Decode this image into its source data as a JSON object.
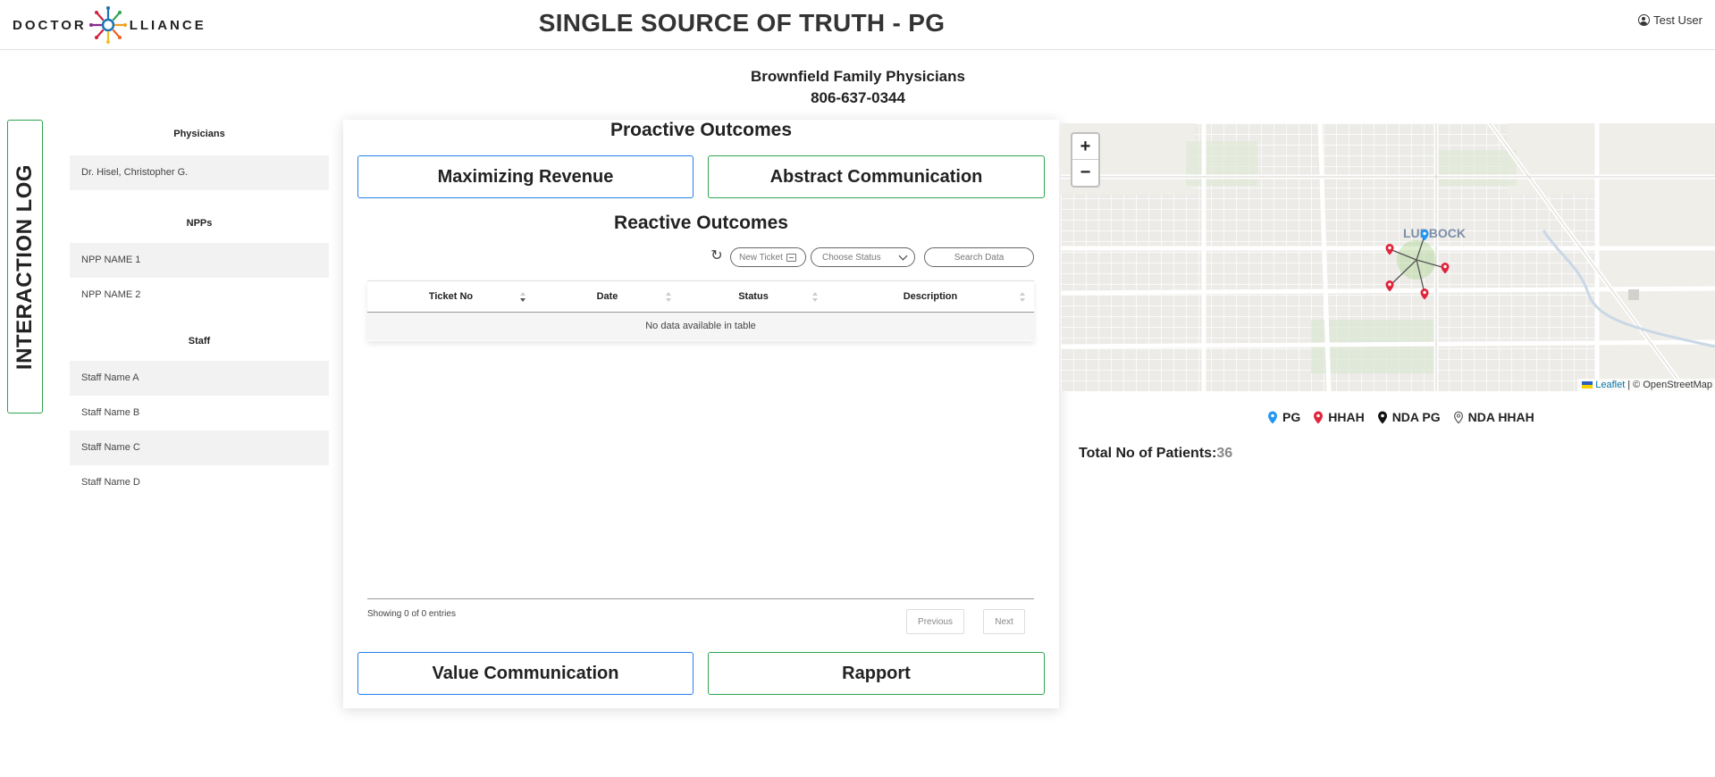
{
  "header": {
    "logo_left": "DOCTOR",
    "logo_right": "LLIANCE",
    "title": "SINGLE SOURCE OF TRUTH - PG",
    "user": "Test User"
  },
  "practice": {
    "name": "Brownfield Family Physicians",
    "phone": "806-637-0344"
  },
  "interaction_log": "INTERACTION LOG",
  "people": {
    "physicians_title": "Physicians",
    "physicians": [
      "Dr. Hisel, Christopher G."
    ],
    "npps_title": "NPPs",
    "npps": [
      "NPP NAME 1",
      "NPP NAME 2"
    ],
    "staff_title": "Staff",
    "staff": [
      "Staff Name A",
      "Staff Name B",
      "Staff Name C",
      "Staff Name D"
    ]
  },
  "center": {
    "proactive_title": "Proactive Outcomes",
    "maximizing_revenue": "Maximizing Revenue",
    "abstract_communication": "Abstract Communication",
    "reactive_title": "Reactive Outcomes",
    "new_ticket": "New Ticket",
    "choose_status": "Choose Status",
    "search_placeholder": "Search Data",
    "columns": [
      "Ticket No",
      "Date",
      "Status",
      "Description"
    ],
    "empty_message": "No data available in table",
    "showing": "Showing 0 of 0 entries",
    "previous": "Previous",
    "next": "Next",
    "value_communication": "Value Communication",
    "rapport": "Rapport"
  },
  "map": {
    "city_label": "LUBBOCK",
    "zoom_in": "+",
    "zoom_out": "−",
    "attribution_leaflet": "Leaflet",
    "attribution_osm": "| © OpenStreetMap",
    "legend": [
      {
        "label": "PG",
        "color": "#2196f3",
        "style": "filled"
      },
      {
        "label": "HHAH",
        "color": "#e0243c",
        "style": "filled"
      },
      {
        "label": "NDA PG",
        "color": "#111111",
        "style": "filled"
      },
      {
        "label": "NDA HHAH",
        "color": "#555555",
        "style": "outline"
      }
    ]
  },
  "patients": {
    "label": "Total No of Patients:",
    "count": "36"
  }
}
